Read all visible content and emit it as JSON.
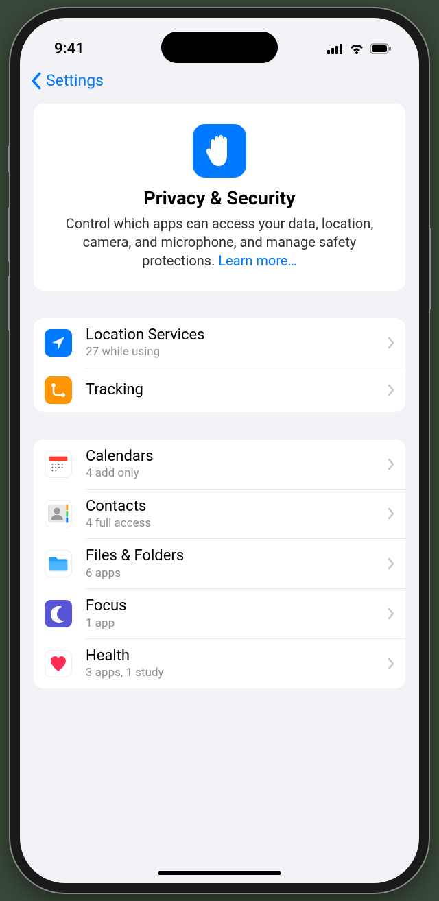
{
  "status": {
    "time": "9:41"
  },
  "nav": {
    "back_label": "Settings"
  },
  "hero": {
    "title": "Privacy & Security",
    "description": "Control which apps can access your data, location, camera, and microphone, and manage safety protections. ",
    "learn_more": "Learn more…"
  },
  "section1": {
    "items": [
      {
        "title": "Location Services",
        "sub": "27 while using"
      },
      {
        "title": "Tracking",
        "sub": ""
      }
    ]
  },
  "section2": {
    "items": [
      {
        "title": "Calendars",
        "sub": "4 add only"
      },
      {
        "title": "Contacts",
        "sub": "4 full access"
      },
      {
        "title": "Files & Folders",
        "sub": "6 apps"
      },
      {
        "title": "Focus",
        "sub": "1 app"
      },
      {
        "title": "Health",
        "sub": "3 apps, 1 study"
      }
    ]
  }
}
